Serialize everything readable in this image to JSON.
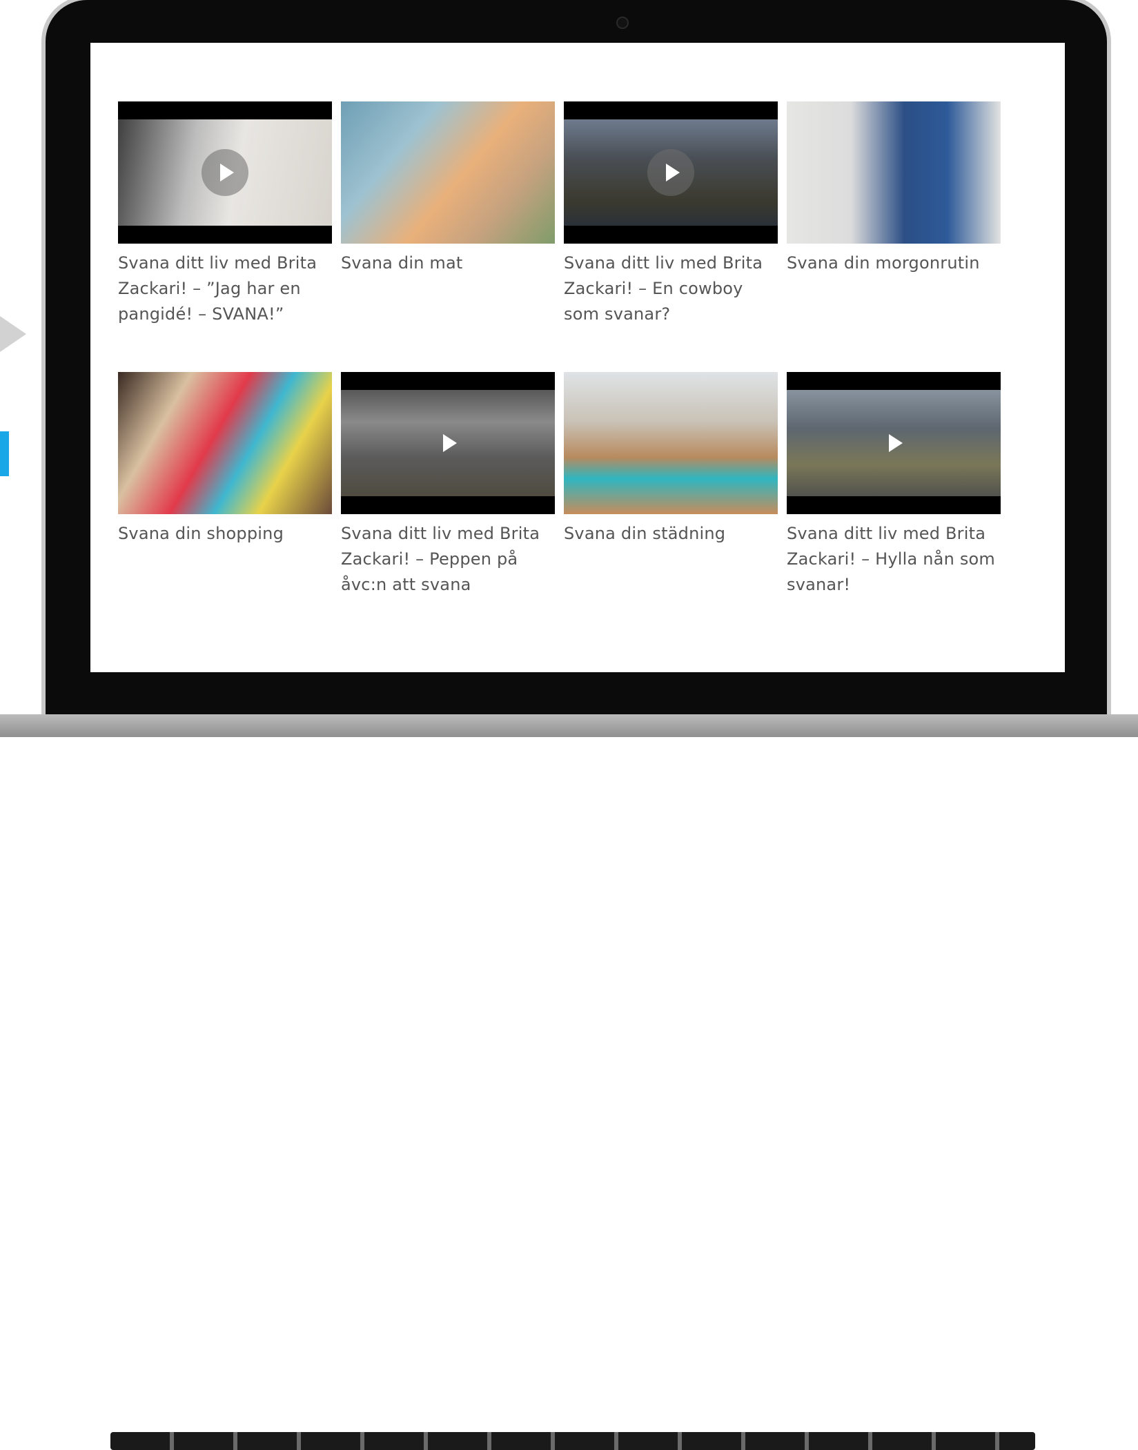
{
  "videos": [
    {
      "title": "Svana ditt liv med Brita Zackari! – ”Jag har en pangidé! – SVANA!”"
    },
    {
      "title": "Svana din mat"
    },
    {
      "title": "Svana ditt liv med Brita Zackari! – En cowboy som svanar?"
    },
    {
      "title": "Svana din morgonrutin"
    },
    {
      "title": "Svana din shopping"
    },
    {
      "title": "Svana ditt liv med Brita Zackari! – Peppen på åvc:n att svana"
    },
    {
      "title": "Svana din städning"
    },
    {
      "title": "Svana ditt liv med Brita Zackari! – Hylla nån som svanar!"
    }
  ],
  "colors": {
    "accent": "#1aa7e8",
    "text": "#555555"
  },
  "icons": [
    "play-icon",
    "scroll-up-icon",
    "scroll-down-icon"
  ]
}
